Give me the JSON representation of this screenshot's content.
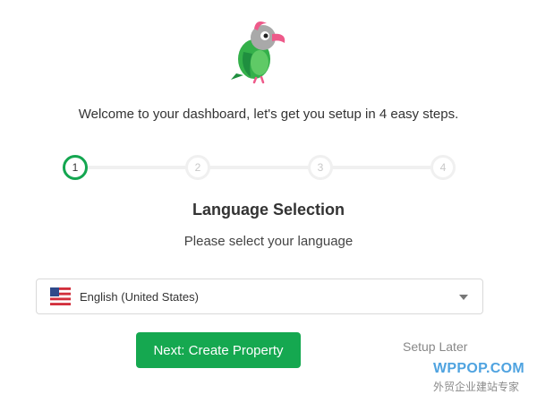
{
  "header": {
    "logo_icon": "parrot-logo-icon",
    "welcome_text": "Welcome to your dashboard, let's get you setup in 4 easy steps."
  },
  "stepper": {
    "current_step": 1,
    "steps": [
      "1",
      "2",
      "3",
      "4"
    ],
    "active_color": "#14a650",
    "inactive_color": "#f0f0f0"
  },
  "section": {
    "title": "Language Selection",
    "subtitle": "Please select your language"
  },
  "language_select": {
    "flag_icon": "us-flag-icon",
    "selected_value": "English (United States)",
    "dropdown_icon": "caret-down-icon"
  },
  "actions": {
    "primary_label": "Next: Create Property",
    "primary_color": "#15a850",
    "secondary_label": "Setup Later"
  },
  "watermark": {
    "brand": "WPPOP.COM",
    "tagline": "外贸企业建站专家"
  }
}
